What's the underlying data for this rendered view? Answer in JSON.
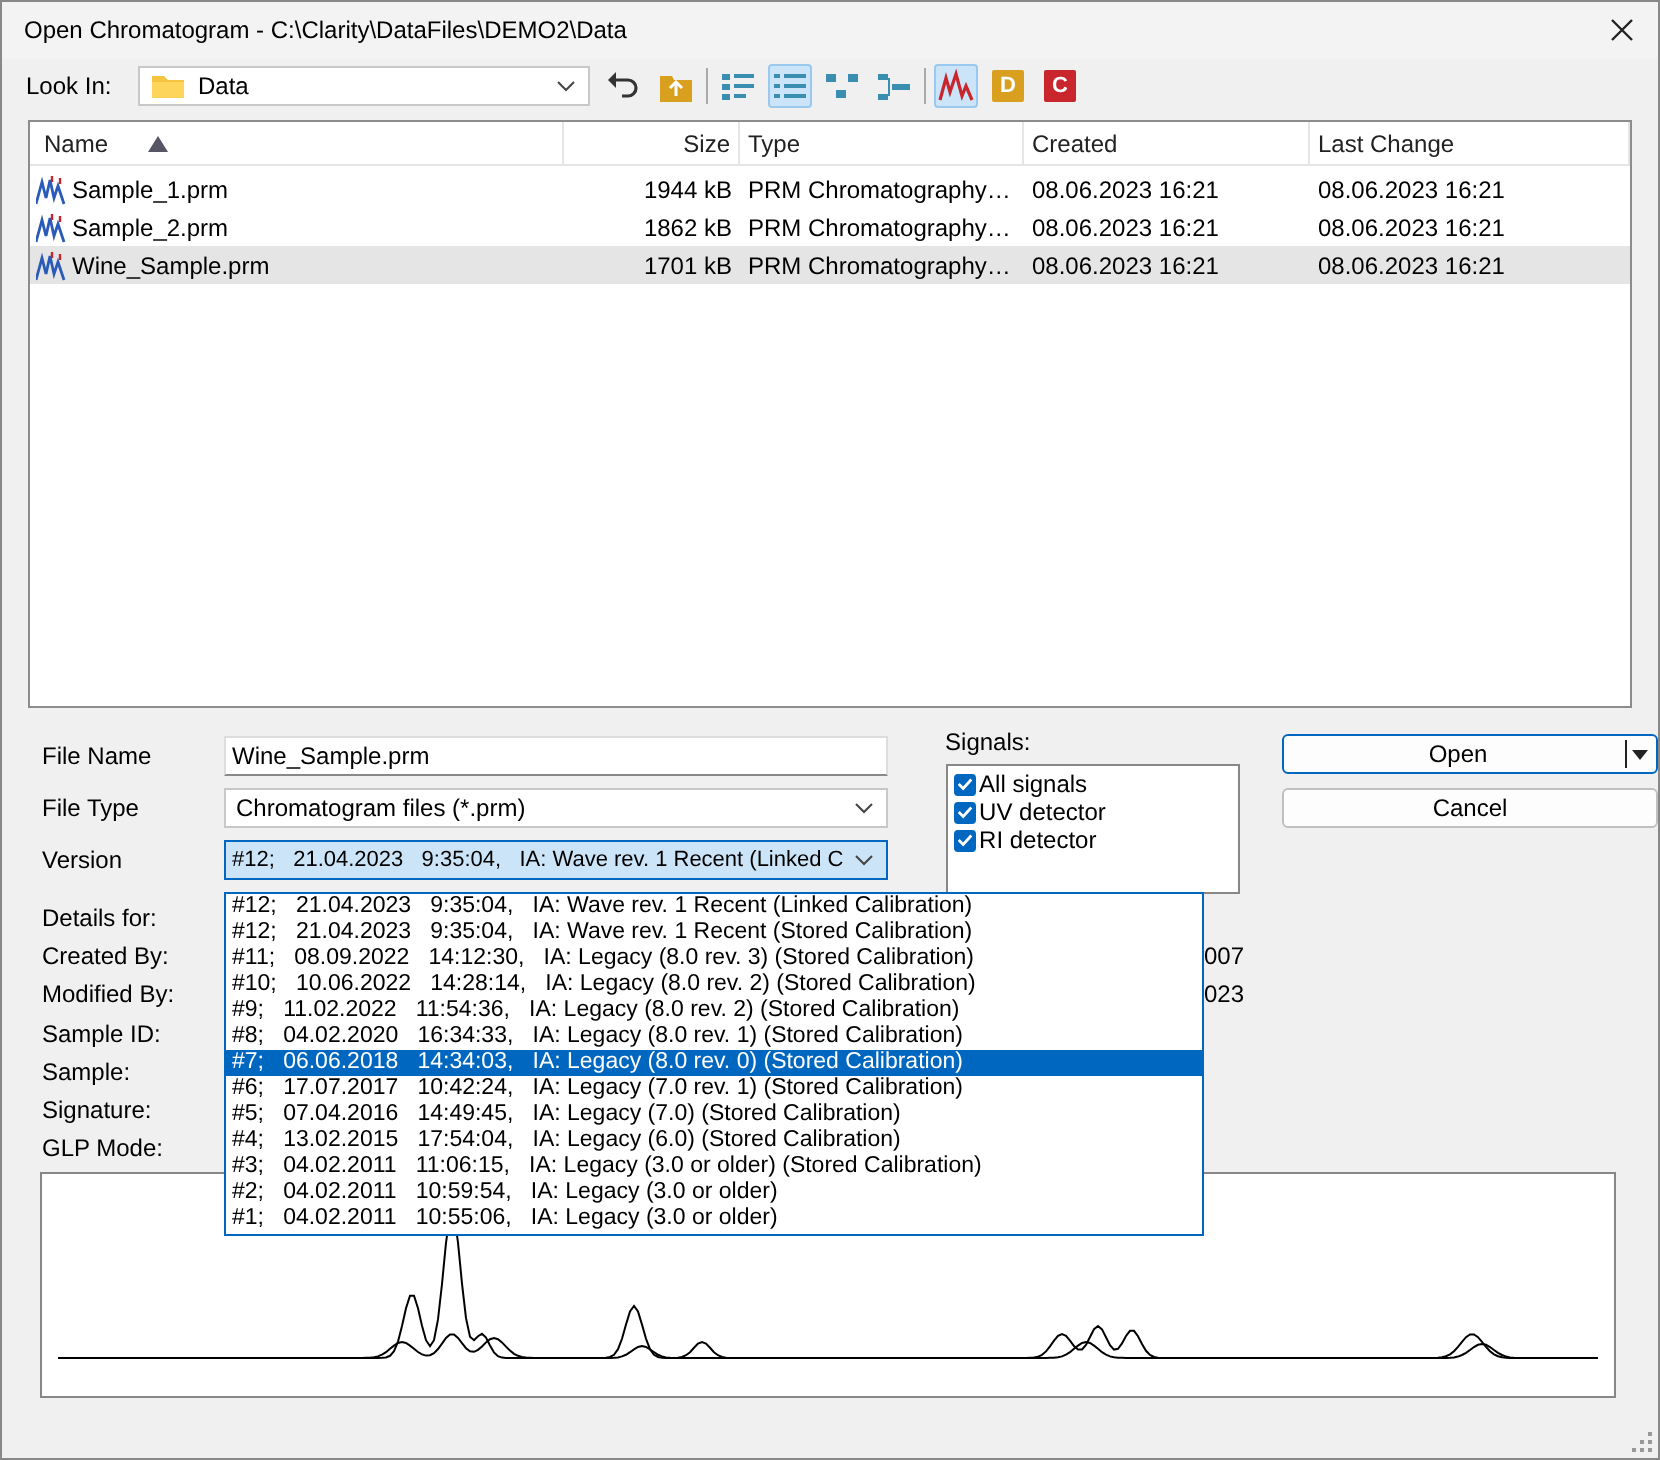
{
  "window": {
    "title": "Open Chromatogram - C:\\Clarity\\DataFiles\\DEMO2\\Data"
  },
  "toolbar": {
    "look_in_label": "Look In:",
    "look_in_value": "Data",
    "buttons": [
      {
        "kind": "back",
        "selected": false
      },
      {
        "kind": "up",
        "selected": false
      },
      {
        "kind": "details",
        "selected": false
      },
      {
        "kind": "list",
        "selected": true
      },
      {
        "kind": "tree",
        "selected": false
      },
      {
        "kind": "tree2",
        "selected": false
      },
      {
        "kind": "chromatogram",
        "selected": true
      },
      {
        "kind": "letter",
        "label": "D",
        "color": "#d9a020",
        "selected": false
      },
      {
        "kind": "letter",
        "label": "C",
        "color": "#c8262c",
        "selected": false
      }
    ]
  },
  "file_list": {
    "columns": [
      {
        "label": "Name",
        "sorted": true
      },
      {
        "label": "Size",
        "sorted": false
      },
      {
        "label": "Type",
        "sorted": false
      },
      {
        "label": "Created",
        "sorted": false
      },
      {
        "label": "Last Change",
        "sorted": false
      }
    ],
    "rows": [
      {
        "name": "Sample_1.prm",
        "size": "1944 kB",
        "type": "PRM Chromatography…",
        "created": "08.06.2023 16:21",
        "last_change": "08.06.2023 16:21",
        "selected": false
      },
      {
        "name": "Sample_2.prm",
        "size": "1862 kB",
        "type": "PRM Chromatography…",
        "created": "08.06.2023 16:21",
        "last_change": "08.06.2023 16:21",
        "selected": false
      },
      {
        "name": "Wine_Sample.prm",
        "size": "1701 kB",
        "type": "PRM Chromatography…",
        "created": "08.06.2023 16:21",
        "last_change": "08.06.2023 16:21",
        "selected": true
      }
    ]
  },
  "form": {
    "file_name_label": "File Name",
    "file_name": "Wine_Sample.prm",
    "file_type_label": "File Type",
    "file_type": "Chromatogram files (*.prm)",
    "version_label": "Version",
    "version": "#12;   21.04.2023   9:35:04,   IA: Wave rev. 1 Recent (Linked C"
  },
  "signals": {
    "label": "Signals:",
    "items": [
      {
        "label": "All signals",
        "checked": true
      },
      {
        "label": "UV detector",
        "checked": true
      },
      {
        "label": "RI detector",
        "checked": true
      }
    ]
  },
  "buttons": {
    "open": "Open",
    "cancel": "Cancel"
  },
  "details": [
    {
      "label": "Details for:"
    },
    {
      "label": "Created By:",
      "value": "007"
    },
    {
      "label": "Modified By:",
      "value": "023"
    },
    {
      "label": "Sample ID:"
    },
    {
      "label": "Sample:"
    },
    {
      "label": "Signature:"
    },
    {
      "label": "GLP Mode:"
    }
  ],
  "version_list": [
    {
      "text": "#12;   21.04.2023   9:35:04,   IA: Wave rev. 1 Recent (Linked Calibration)",
      "selected": false
    },
    {
      "text": "#12;   21.04.2023   9:35:04,   IA: Wave rev. 1 Recent (Stored Calibration)",
      "selected": false
    },
    {
      "text": "#11;   08.09.2022   14:12:30,   IA: Legacy (8.0 rev. 3) (Stored Calibration)",
      "selected": false
    },
    {
      "text": "#10;   10.06.2022   14:28:14,   IA: Legacy (8.0 rev. 2) (Stored Calibration)",
      "selected": false
    },
    {
      "text": "#9;   11.02.2022   11:54:36,   IA: Legacy (8.0 rev. 2) (Stored Calibration)",
      "selected": false
    },
    {
      "text": "#8;   04.02.2020   16:34:33,   IA: Legacy (8.0 rev. 1) (Stored Calibration)",
      "selected": false
    },
    {
      "text": "#7;   06.06.2018   14:34:03,   IA: Legacy (8.0 rev. 0) (Stored Calibration)",
      "selected": true
    },
    {
      "text": "#6;   17.07.2017   10:42:24,   IA: Legacy (7.0 rev. 1) (Stored Calibration)",
      "selected": false
    },
    {
      "text": "#5;   07.04.2016   14:49:45,   IA: Legacy (7.0) (Stored Calibration)",
      "selected": false
    },
    {
      "text": "#4;   13.02.2015   17:54:04,   IA: Legacy (6.0) (Stored Calibration)",
      "selected": false
    },
    {
      "text": "#3;   04.02.2011   11:06:15,   IA: Legacy (3.0 or older) (Stored Calibration)",
      "selected": false
    },
    {
      "text": "#2;   04.02.2011   10:59:54,   IA: Legacy (3.0 or older)",
      "selected": false
    },
    {
      "text": "#1;   04.02.2011   10:55:06,   IA: Legacy (3.0 or older)",
      "selected": false
    }
  ]
}
